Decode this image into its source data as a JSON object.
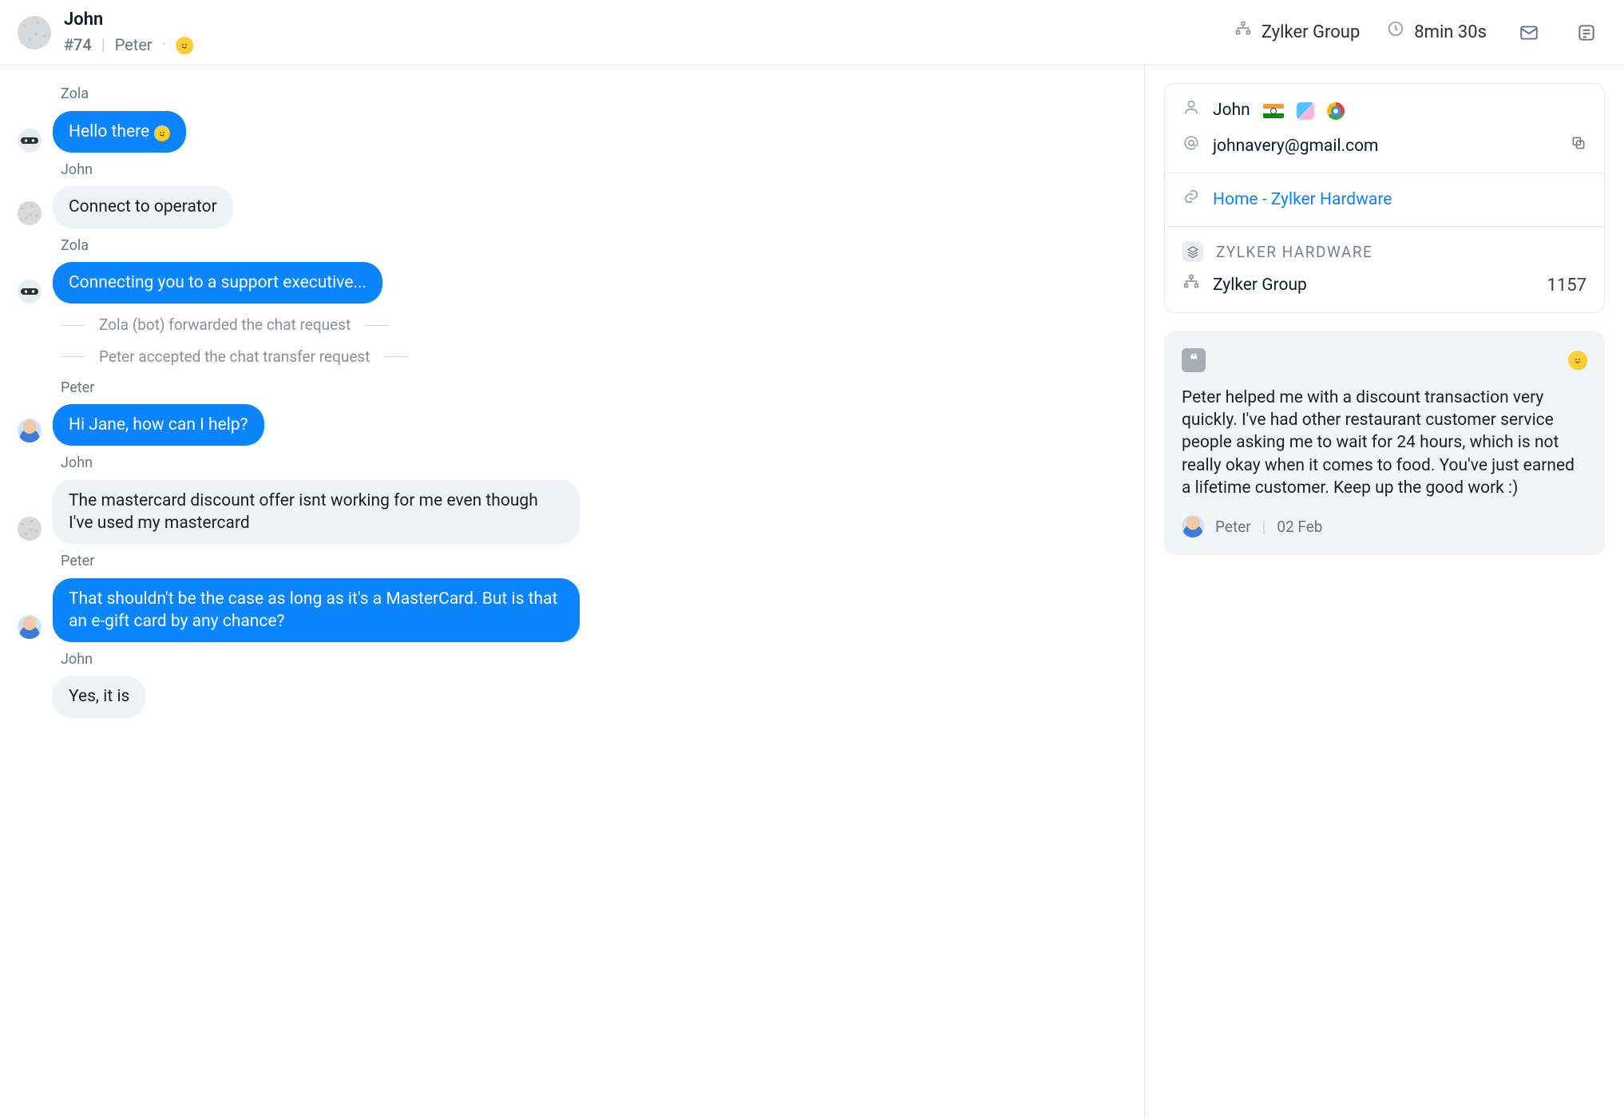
{
  "header": {
    "customer_name": "John",
    "ticket_id": "#74",
    "agent_name": "Peter",
    "org_name": "Zylker Group",
    "duration": "8min 30s"
  },
  "messages": [
    {
      "kind": "msg",
      "sender": "Zola",
      "avatar": "bot",
      "style": "blue",
      "text": "Hello there",
      "smiley": true
    },
    {
      "kind": "msg",
      "sender": "John",
      "avatar": "noise",
      "style": "grey",
      "text": "Connect to operator"
    },
    {
      "kind": "msg",
      "sender": "Zola",
      "avatar": "bot",
      "style": "blue",
      "text": "Connecting you to a support executive..."
    },
    {
      "kind": "sys",
      "text": "Zola (bot) forwarded the chat request"
    },
    {
      "kind": "sys",
      "text": "Peter accepted the chat transfer request"
    },
    {
      "kind": "msg",
      "sender": "Peter",
      "avatar": "human",
      "style": "blue",
      "text": "Hi Jane, how can I help?"
    },
    {
      "kind": "msg",
      "sender": "John",
      "avatar": "noise",
      "style": "grey",
      "text": "The mastercard discount offer isnt working for me even though I've used my mastercard"
    },
    {
      "kind": "msg",
      "sender": "Peter",
      "avatar": "human",
      "style": "blue",
      "text": "That shouldn't be the case as long as it's a MasterCard. But is that an e-gift card by any chance?"
    },
    {
      "kind": "msg",
      "sender": "John",
      "avatar": "none",
      "style": "grey",
      "text": "Yes, it is"
    }
  ],
  "sidebar": {
    "customer_name": "John",
    "email": "johnavery@gmail.com",
    "page_link": "Home - Zylker Hardware",
    "department_label": "ZYLKER HARDWARE",
    "group_name": "Zylker Group",
    "group_number": "1157",
    "review": {
      "text": "Peter helped me with a discount transaction very quickly. I've had other restaurant customer service people asking me to wait for 24 hours, which is not really okay when it comes to food. You've just earned a lifetime customer. Keep up the good work :)",
      "author": "Peter",
      "date": "02 Feb"
    }
  }
}
